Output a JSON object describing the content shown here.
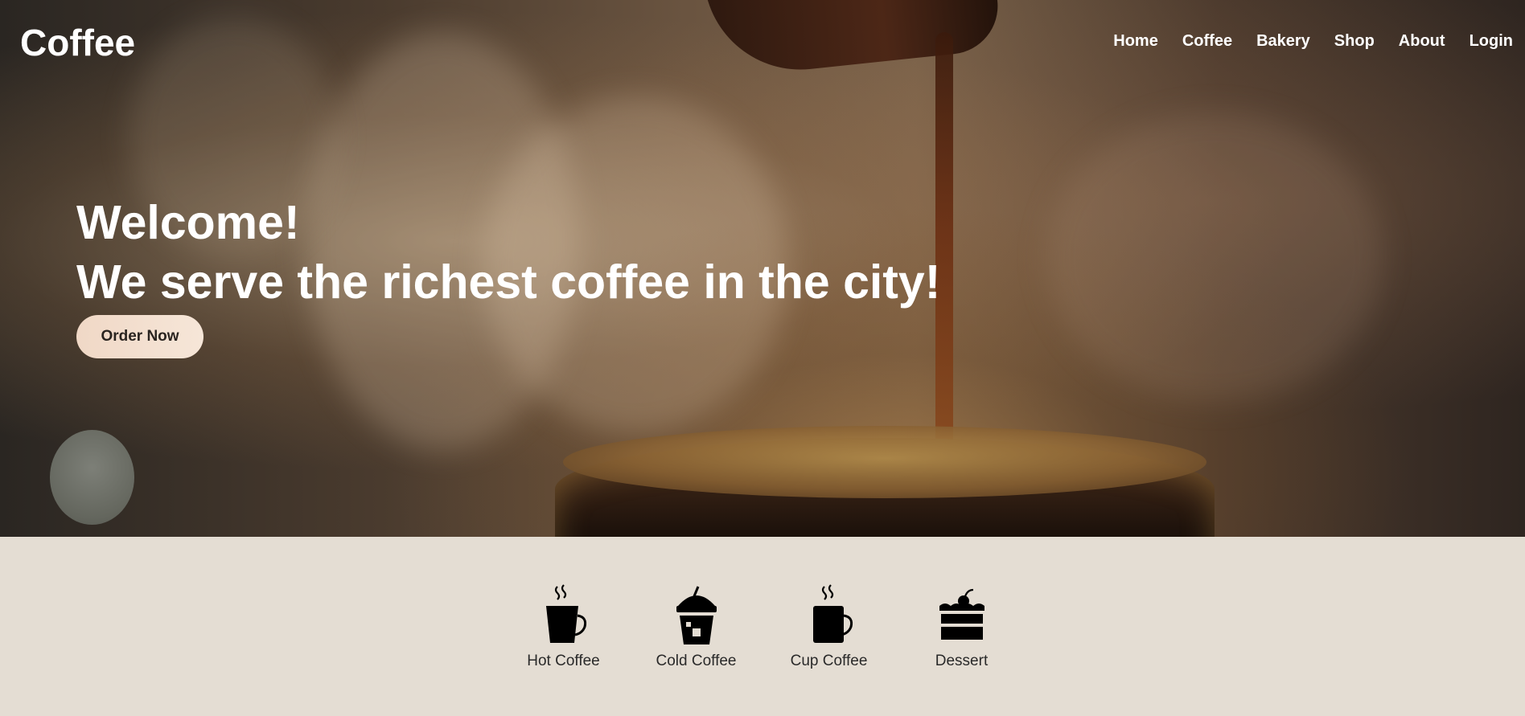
{
  "header": {
    "logo": "Coffee",
    "nav": [
      {
        "label": "Home",
        "key": "home"
      },
      {
        "label": "Coffee",
        "key": "coffee"
      },
      {
        "label": "Bakery",
        "key": "bakery"
      },
      {
        "label": "Shop",
        "key": "shop"
      },
      {
        "label": "About",
        "key": "about"
      },
      {
        "label": "Login",
        "key": "login"
      }
    ]
  },
  "hero": {
    "line1": "Welcome!",
    "line2": "We serve the richest coffee in the city!",
    "cta_label": "Order Now"
  },
  "categories": [
    {
      "label": "Hot Coffee",
      "icon": "hot-coffee-icon"
    },
    {
      "label": "Cold Coffee",
      "icon": "cold-coffee-icon"
    },
    {
      "label": "Cup Coffee",
      "icon": "cup-coffee-icon"
    },
    {
      "label": "Dessert",
      "icon": "dessert-icon"
    }
  ],
  "colors": {
    "cta_background": "#f3dfce",
    "section_background": "#e4ddd3",
    "hero_text": "#ffffff"
  }
}
